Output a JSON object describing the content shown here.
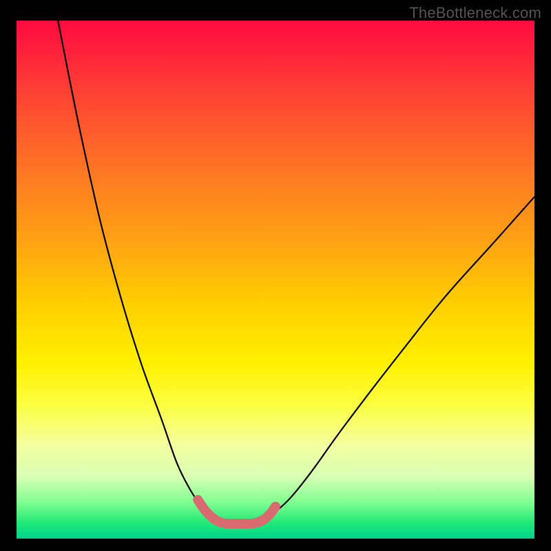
{
  "watermark": "TheBottleneck.com",
  "colors": {
    "background": "#000000",
    "curve_stroke": "#000000",
    "bottom_marker": "#d96a6f"
  },
  "chart_data": {
    "type": "line",
    "title": "",
    "xlabel": "",
    "ylabel": "",
    "xlim": [
      0,
      100
    ],
    "ylim": [
      0,
      100
    ],
    "series": [
      {
        "name": "left-curve",
        "x": [
          8,
          12,
          16,
          20,
          24,
          28,
          31,
          33.5,
          35.5,
          37,
          38.5,
          40
        ],
        "values": [
          100,
          80,
          62,
          47,
          34,
          23,
          14.5,
          9.5,
          6.5,
          4.7,
          3.6,
          3.0
        ]
      },
      {
        "name": "right-curve",
        "x": [
          46,
          48,
          50,
          53,
          57,
          62,
          68,
          75,
          83,
          92,
          100
        ],
        "values": [
          3.0,
          3.8,
          5.2,
          8.0,
          13,
          20,
          28,
          37,
          47,
          57,
          66
        ]
      },
      {
        "name": "bottom-marker",
        "x": [
          35,
          36,
          37,
          38,
          39,
          40,
          41,
          42,
          43,
          44,
          45,
          46,
          47,
          48,
          49,
          50
        ],
        "values": [
          7.5,
          6.0,
          4.8,
          3.9,
          3.3,
          3.0,
          2.9,
          2.9,
          2.9,
          2.9,
          2.9,
          3.0,
          3.3,
          3.9,
          4.8,
          6.2
        ]
      }
    ],
    "annotations": []
  }
}
